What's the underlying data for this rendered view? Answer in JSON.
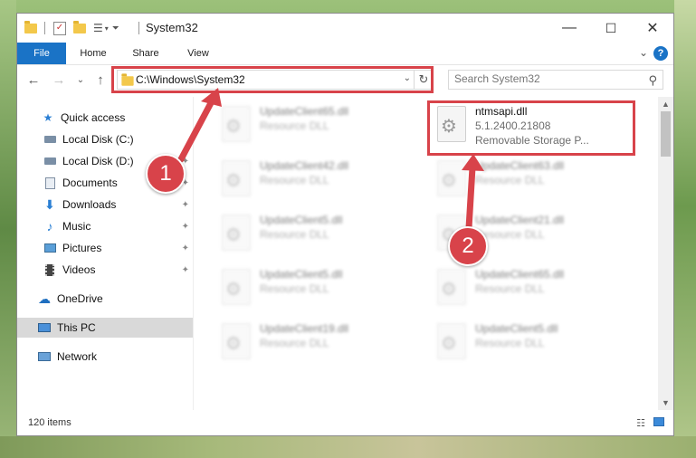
{
  "window": {
    "title": "System32",
    "controls": {
      "minimize": "—",
      "maximize": "☐",
      "close": "✕"
    }
  },
  "ribbon": {
    "tabs": [
      "File",
      "Home",
      "Share",
      "View"
    ],
    "help": "?",
    "expand": "⌄"
  },
  "nav": {
    "back": "←",
    "forward": "→",
    "recent": "⌄",
    "up": "↑",
    "address": "C:\\Windows\\System32",
    "address_drop": "⌄",
    "refresh": "↻",
    "search_placeholder": "Search System32"
  },
  "sidebar": {
    "items": [
      {
        "label": "Quick access",
        "icon": "star-icon"
      },
      {
        "label": "Local Disk (C:)",
        "icon": "drive-icon",
        "pinned": true
      },
      {
        "label": "Local Disk (D:)",
        "icon": "drive-icon",
        "pinned": true
      },
      {
        "label": "Documents",
        "icon": "documents-icon",
        "pinned": true
      },
      {
        "label": "Downloads",
        "icon": "download-icon",
        "pinned": true
      },
      {
        "label": "Music",
        "icon": "music-icon",
        "pinned": true
      },
      {
        "label": "Pictures",
        "icon": "pictures-icon",
        "pinned": true
      },
      {
        "label": "Videos",
        "icon": "videos-icon",
        "pinned": true
      },
      {
        "label": "OneDrive",
        "icon": "cloud-icon"
      },
      {
        "label": "This PC",
        "icon": "computer-icon",
        "selected": true
      },
      {
        "label": "Network",
        "icon": "network-icon"
      }
    ],
    "pin_glyph": "📌"
  },
  "files": [
    {
      "name": "UpdateClient65.dll",
      "type": "Resource DLL",
      "blurred": true
    },
    {
      "name": "ntmsapi.dll",
      "version": "5.1.2400.21808",
      "description": "Removable Storage P...",
      "blurred": false,
      "highlighted": true
    },
    {
      "name": "UpdateClient42.dll",
      "type": "Resource DLL",
      "blurred": true
    },
    {
      "name": "UpdateClient63.dll",
      "type": "Resource DLL",
      "blurred": true
    },
    {
      "name": "UpdateClient5.dll",
      "type": "Resource DLL",
      "blurred": true
    },
    {
      "name": "UpdateClient21.dll",
      "type": "Resource DLL",
      "blurred": true
    },
    {
      "name": "UpdateClient5.dll",
      "type": "Resource DLL",
      "blurred": true
    },
    {
      "name": "UpdateClient65.dll",
      "type": "Resource DLL",
      "blurred": true
    },
    {
      "name": "UpdateClient19.dll",
      "type": "Resource DLL",
      "blurred": true
    },
    {
      "name": "UpdateClient5.dll",
      "type": "Resource DLL",
      "blurred": true
    }
  ],
  "status": {
    "count": "120 items"
  },
  "callouts": [
    "1",
    "2"
  ],
  "colors": {
    "accent": "#1a73c6",
    "highlight": "#d8434a",
    "folder": "#f3c84b"
  }
}
